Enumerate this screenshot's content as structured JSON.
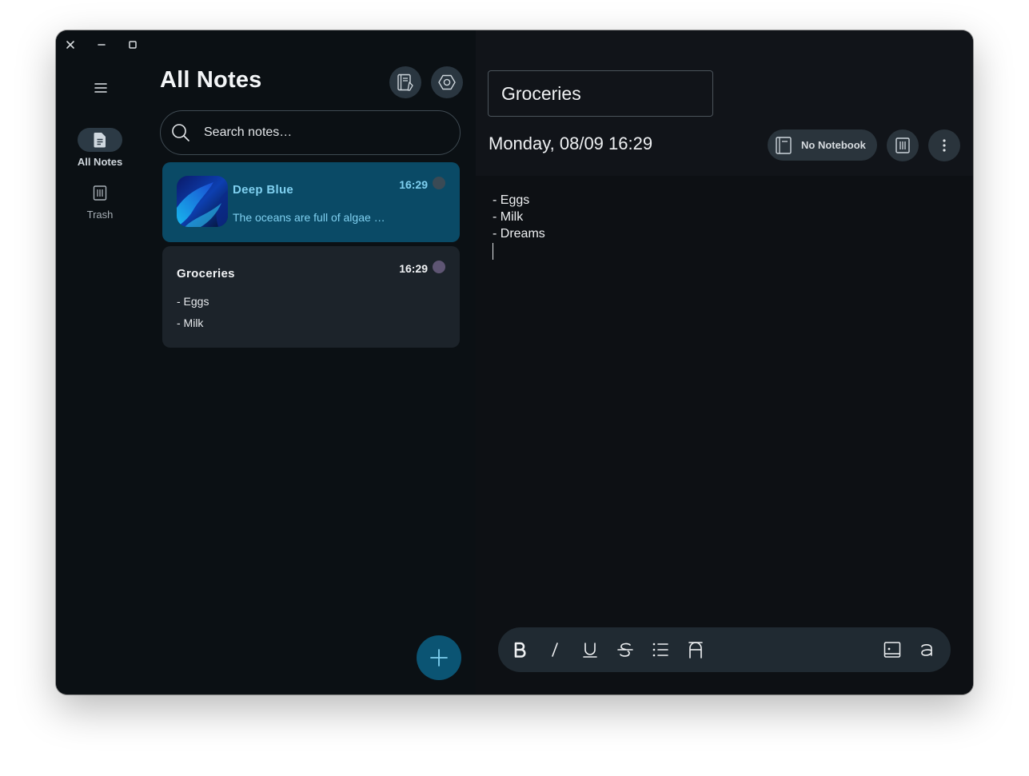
{
  "list": {
    "title": "All Notes",
    "search_placeholder": "Search notes…"
  },
  "rail": {
    "items": [
      {
        "label": "All Notes",
        "icon": "note-icon",
        "active": true
      },
      {
        "label": "Trash",
        "icon": "trash-icon",
        "active": false
      }
    ]
  },
  "notes": [
    {
      "title": "Deep Blue",
      "time": "16:29",
      "preview": "The oceans are full of algae …",
      "has_image": true,
      "dot_color": "#3a4a55",
      "selected": true
    },
    {
      "title": "Groceries",
      "time": "16:29",
      "preview_lines": [
        "- Eggs",
        "- Milk"
      ],
      "dot_color": "#5e5573",
      "selected": false
    }
  ],
  "editor": {
    "title_value": "Groceries",
    "date": "Monday, 08/09 16:29",
    "notebook_label": "No Notebook",
    "content_lines": [
      "- Eggs",
      "- Milk",
      "- Dreams"
    ]
  },
  "toolbar_items": [
    "bold",
    "italic",
    "underline",
    "strikethrough",
    "bullet-list",
    "font",
    "insert-image",
    "text-style"
  ],
  "colors": {
    "accent": "#0b5473",
    "selected_card": "#0a4a66",
    "accent_text": "#7fd0f0"
  }
}
